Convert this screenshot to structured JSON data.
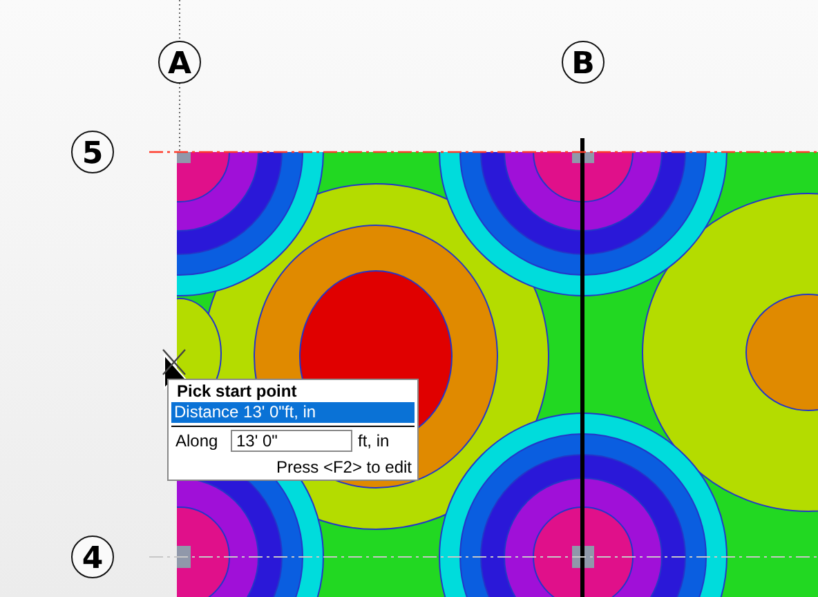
{
  "grid_lines": [
    {
      "kind": "column",
      "label": "A"
    },
    {
      "kind": "column",
      "label": "B"
    },
    {
      "kind": "row",
      "label": "5"
    },
    {
      "kind": "row",
      "label": "4"
    }
  ],
  "tooltip": {
    "title": "Pick start point",
    "options": [
      {
        "label": "Distance 13' 0\"ft, in",
        "selected": true
      }
    ],
    "fields": [
      {
        "label": "Along",
        "value": "13' 0\"",
        "unit": "ft, in"
      }
    ],
    "hint": "Press <F2> to edit"
  }
}
